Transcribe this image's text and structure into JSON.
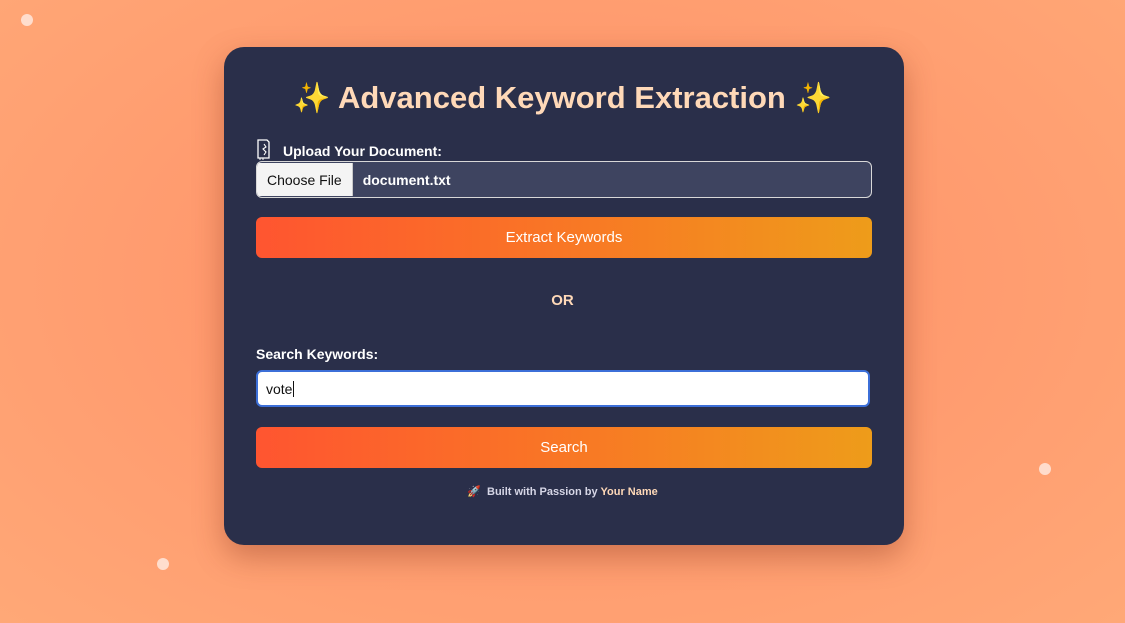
{
  "header": {
    "title": "Advanced Keyword Extraction",
    "spark_left": "✨",
    "spark_right": "✨"
  },
  "upload": {
    "label": "Upload Your Document:",
    "choose_button_label": "Choose File",
    "file_name": "document.txt"
  },
  "extract_button_label": "Extract Keywords",
  "divider_text": "OR",
  "search": {
    "label": "Search Keywords:",
    "value": "vote",
    "button_label": "Search"
  },
  "footer": {
    "prefix": "Built with Passion by",
    "name": "Your Name",
    "rocket_icon": "🚀"
  },
  "colors": {
    "card_background": "#2a2f4a",
    "title": "#ffd9b8",
    "button_gradient_start": "#ff5530",
    "button_gradient_end": "#ee9c1a",
    "page_background": "#ff9a6e",
    "input_focus_border": "#3c6fd8"
  }
}
